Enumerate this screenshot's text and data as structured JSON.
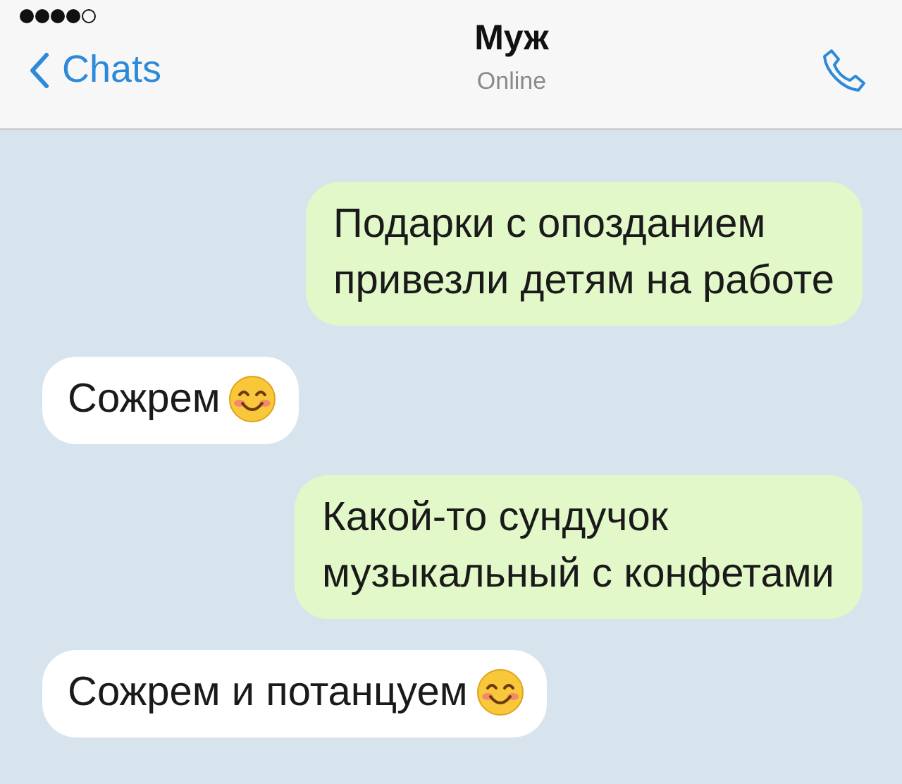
{
  "header": {
    "back_label": "Chats",
    "title": "Муж",
    "subtitle": "Online"
  },
  "messages": [
    {
      "kind": "outgoing",
      "lines": [
        "Подарки с опозданием",
        "привезли детям на работе"
      ],
      "emoji": false
    },
    {
      "kind": "incoming",
      "lines": [
        "Сожрем"
      ],
      "emoji": true
    },
    {
      "kind": "outgoing",
      "lines": [
        "Какой-то сундучок",
        "музыкальный с конфетами"
      ],
      "emoji": false
    },
    {
      "kind": "incoming",
      "lines": [
        "Сожрем и потанцуем"
      ],
      "emoji": true
    }
  ]
}
